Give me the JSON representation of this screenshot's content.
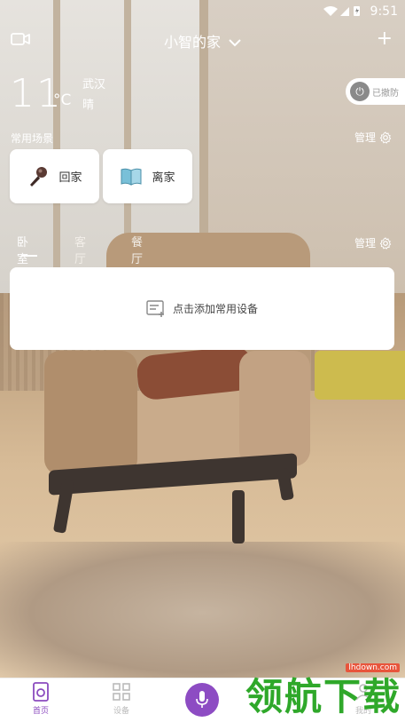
{
  "status_bar": {
    "time": "9:51"
  },
  "header": {
    "home_name": "小智的家"
  },
  "weather": {
    "temperature": "11",
    "unit": "°C",
    "city": "武汉",
    "condition": "晴"
  },
  "security": {
    "label": "已撤防"
  },
  "scenes": {
    "title": "常用场景",
    "manage_label": "管理",
    "items": [
      {
        "label": "回家",
        "icon": "microphone-icon"
      },
      {
        "label": "离家",
        "icon": "book-icon"
      }
    ]
  },
  "rooms": {
    "manage_label": "管理",
    "tabs": [
      {
        "label": "卧室",
        "active": true
      },
      {
        "label": "客厅",
        "active": false
      },
      {
        "label": "餐厅",
        "active": false
      }
    ]
  },
  "devices": {
    "empty_label": "点击添加常用设备"
  },
  "bottom_nav": {
    "items": [
      {
        "label": "首页",
        "active": true
      },
      {
        "label": "设备",
        "active": false
      },
      {
        "label": "我的",
        "active": false
      }
    ]
  },
  "watermark": {
    "text": "领航下载",
    "url": "lhdown.com"
  },
  "colors": {
    "accent": "#8d4cc3",
    "watermark": "#2fa82a"
  }
}
